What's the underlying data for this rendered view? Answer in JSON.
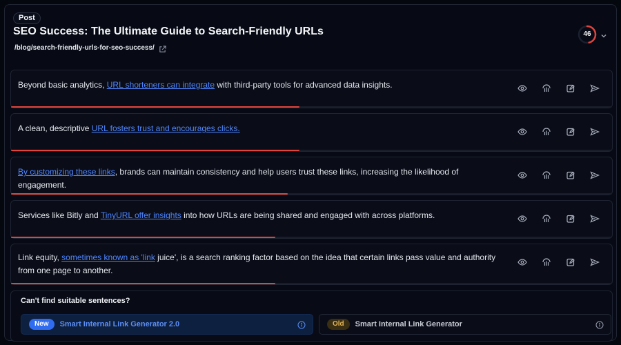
{
  "header": {
    "badge": "Post",
    "title": "SEO Success: The Ultimate Guide to Search-Friendly URLs",
    "slug": "/blog/search-friendly-urls-for-seo-success/",
    "score": "46",
    "score_progress": 0.46,
    "score_color": "#e0443c"
  },
  "suggestions": [
    {
      "before": "Beyond basic analytics, ",
      "link": "URL shorteners can integrate",
      "after": " with third-party tools for advanced data insights.",
      "relevance": 0.48
    },
    {
      "before": "A clean, descriptive ",
      "link": "URL fosters trust and encourages clicks.",
      "after": "",
      "relevance": 0.48
    },
    {
      "before": "",
      "link": "By customizing these links",
      "after": ", brands can maintain consistency and help users trust these links, increasing the likelihood of engagement.",
      "relevance": 0.46
    },
    {
      "before": "Services like Bitly and ",
      "link": "TinyURL offer insights",
      "after": " into how URLs are being shared and engaged with across platforms.",
      "relevance": 0.44
    },
    {
      "before": "Link equity, ",
      "link": "sometimes known as 'link",
      "after": " juice', is a search ranking factor based on the idea that certain links pass value and authority from one page to another.",
      "relevance": 0.44
    }
  ],
  "actions": [
    "eye-icon",
    "link-suggest-icon",
    "edit-icon",
    "send-icon"
  ],
  "footer": {
    "question": "Can't find suitable sentences?",
    "new_pill": "New",
    "new_label": "Smart Internal Link Generator 2.0",
    "old_pill": "Old",
    "old_label": "Smart Internal Link Generator"
  },
  "colors": {
    "link": "#4f86ff",
    "bar": "#e0443c",
    "new_pill": "#2f6cf0",
    "old_pill": "#e2b45a"
  }
}
